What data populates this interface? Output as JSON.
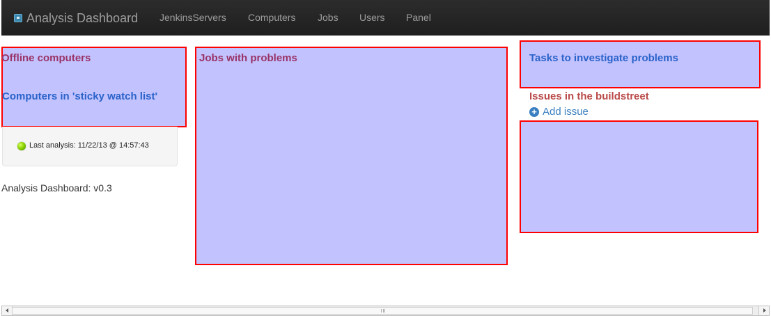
{
  "navbar": {
    "brand": "Analysis Dashboard",
    "brand_icon": "dashboard-icon",
    "links": [
      "JenkinsServers",
      "Computers",
      "Jobs",
      "Users",
      "Panel"
    ]
  },
  "left_panel": {
    "offline_title": "Offline computers",
    "sticky_title": "Computers in 'sticky watch list'",
    "status_icon": "green-status-dot-icon",
    "last_analysis": "Last analysis: 11/22/13 @ 14:57:43",
    "version": "Analysis Dashboard: v0.3"
  },
  "center_panel": {
    "title": "Jobs with problems"
  },
  "right_panel": {
    "tasks_title": "Tasks to investigate problems",
    "issues_title": "Issues in the buildstreet",
    "add_issue_label": "Add issue",
    "add_issue_icon": "plus-circle-icon"
  },
  "scrollbar": {
    "left_icon": "scroll-left-icon",
    "right_icon": "scroll-right-icon",
    "grip_icon": "scroll-grip-icon"
  },
  "colors": {
    "navbar_bg": "#222222",
    "panel_fill": "#c2c2ff",
    "panel_border": "#ff0000",
    "heading_purple": "#993366",
    "heading_blue": "#2a63c9",
    "heading_red": "#b94a48",
    "link_blue": "#3a7fc1"
  }
}
